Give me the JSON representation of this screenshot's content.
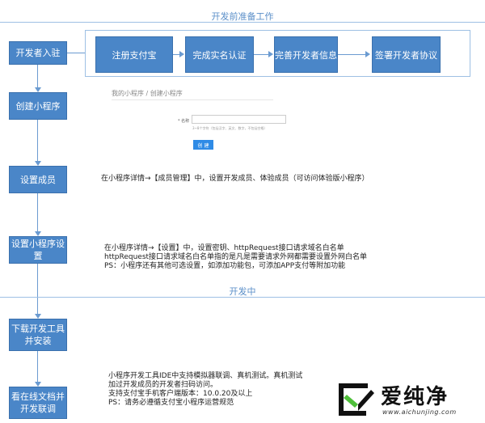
{
  "sections": {
    "prep": "开发前准备工作",
    "dev": "开发中"
  },
  "top_flow": {
    "start": "开发者入驻",
    "steps": [
      "注册支付宝",
      "完成实名认证",
      "完善开发者信息",
      "签署开发者协议"
    ]
  },
  "left_steps": [
    {
      "label": "创建小程序"
    },
    {
      "label": "设置成员"
    },
    {
      "label": "设置小程序设置"
    },
    {
      "label_l1": "下载开发工具",
      "label_l2": "并安装"
    },
    {
      "label_l1": "看在线文档并",
      "label_l2": "开发联调"
    }
  ],
  "create_mock": {
    "breadcrumb": "我的小程序 / 创建小程序",
    "field_label": "* 名称",
    "field_hint": "3~8个字符（包括汉字、英文、数字，不包括空格）",
    "button": "创 建"
  },
  "desc_members": "在小程序详情→【成员管理】中，设置开发成员、体验成员（可访问体验版小程序）",
  "desc_settings": [
    "在小程序详情→【设置】中，设置密钥、httpRequest接口请求域名白名单",
    "httpRequest接口请求域名白名单指的是凡是需要请求外网都需要设置外网白名单",
    "PS：小程序还有其他可选设置，如添加功能包，可添加APP支付等附加功能"
  ],
  "desc_docs": [
    "小程序开发工具IDE中支持模拟器联调、真机测试。真机测试",
    "加过开发成员的开发者扫码访问。",
    "支持支付宝手机客户端版本：10.0.20及以上",
    "PS：请务必遵循支付宝小程序运营规范"
  ],
  "watermark": {
    "brand": "爱纯净",
    "url": "www.aichunjing.com"
  }
}
